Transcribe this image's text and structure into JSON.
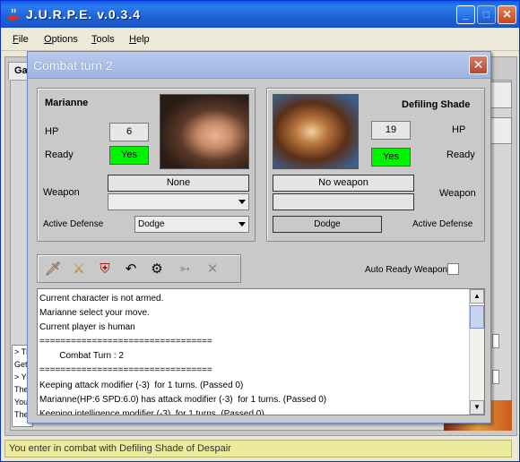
{
  "app": {
    "title": "J.U.R.P.E. v.0.3.4",
    "menu": [
      {
        "pre": "",
        "key": "F",
        "post": "ile"
      },
      {
        "pre": "",
        "key": "O",
        "post": "ptions"
      },
      {
        "pre": "",
        "key": "T",
        "post": "ools"
      },
      {
        "pre": "",
        "key": "H",
        "post": "elp"
      }
    ],
    "bg_tab_label": "Ga",
    "bg_log_lines": [
      "> Th",
      "Get",
      "> Y",
      "The",
      "You",
      "The"
    ],
    "status_text": "You enter in combat with Defiling Shade of Despair"
  },
  "dialog": {
    "title": "Combat turn 2",
    "close_glyph": "✕",
    "player": {
      "name": "Marianne",
      "hp_label": "HP",
      "hp": "6",
      "ready_label": "Ready",
      "ready": "Yes",
      "weapon_label": "Weapon",
      "weapon": "None",
      "weapon_select": "",
      "active_defense_label": "Active Defense",
      "active_defense": "Dodge"
    },
    "enemy": {
      "name": "Defiling Shade",
      "hp_label": "HP",
      "hp": "19",
      "ready_label": "Ready",
      "ready": "Yes",
      "weapon_label": "Weapon",
      "weapon": "No weapon",
      "weapon_extra": "",
      "active_defense_label": "Active Defense",
      "active_defense": "Dodge"
    },
    "toolbar": [
      {
        "name": "attack-sword-icon",
        "glyph": "🗡"
      },
      {
        "name": "all-out-attack-icon",
        "glyph": "⚔"
      },
      {
        "name": "defend-shield-icon",
        "glyph": "⛨"
      },
      {
        "name": "retreat-arrow-icon",
        "glyph": "↶"
      },
      {
        "name": "ready-weapon-icon",
        "glyph": "⚙"
      },
      {
        "name": "aim-ranged-icon",
        "glyph": "➳"
      },
      {
        "name": "cancel-x-icon",
        "glyph": "✕"
      }
    ],
    "auto_ready_label": "Auto Ready Weapon",
    "log": [
      "Current character is not armed.",
      "Marianne select your move.",
      "Current player is human",
      "=================================",
      "        Combat Turn : 2",
      "=================================",
      "Keeping attack modifier (-3)  for 1 turns. (Passed 0)",
      "Marianne(HP:6 SPD:6.0) has attack modifier (-3)  for 1 turns. (Passed 0)",
      "Keeping intelligence modifier (-3)  for 1 turns. (Passed 0)"
    ]
  }
}
